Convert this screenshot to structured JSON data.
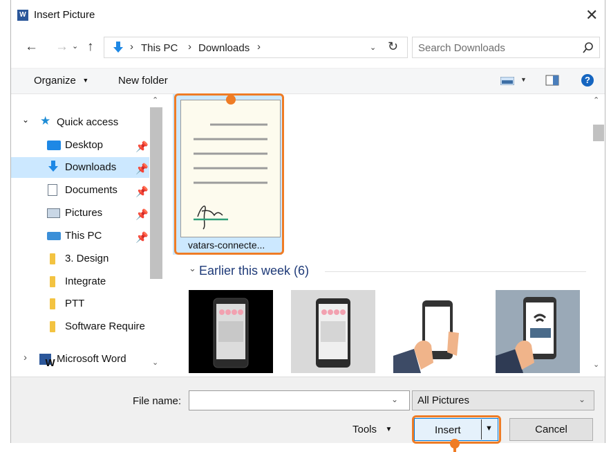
{
  "window": {
    "title": "Insert Picture",
    "app_icon_text": "W"
  },
  "breadcrumb": [
    "This PC",
    "Downloads"
  ],
  "search": {
    "placeholder": "Search Downloads"
  },
  "toolbar": {
    "organize": "Organize",
    "new_folder": "New folder"
  },
  "sidebar": {
    "quick_access": "Quick access",
    "items": [
      "Desktop",
      "Downloads",
      "Documents",
      "Pictures",
      "This PC",
      "3. Design",
      "Integrate",
      "PTT",
      "Software Require"
    ],
    "microsoft_word": "Microsoft Word",
    "word_icon_text": "W"
  },
  "main": {
    "selected_file": "vatars-connecte...",
    "group_header": "Earlier this week (6)"
  },
  "footer": {
    "file_name_label": "File name:",
    "file_name_value": "",
    "filter": "All Pictures",
    "tools": "Tools",
    "insert": "Insert",
    "cancel": "Cancel"
  },
  "colors": {
    "accent_orange": "#ef7c25",
    "selected_bg": "#cce8ff",
    "word_blue": "#2b579a"
  }
}
